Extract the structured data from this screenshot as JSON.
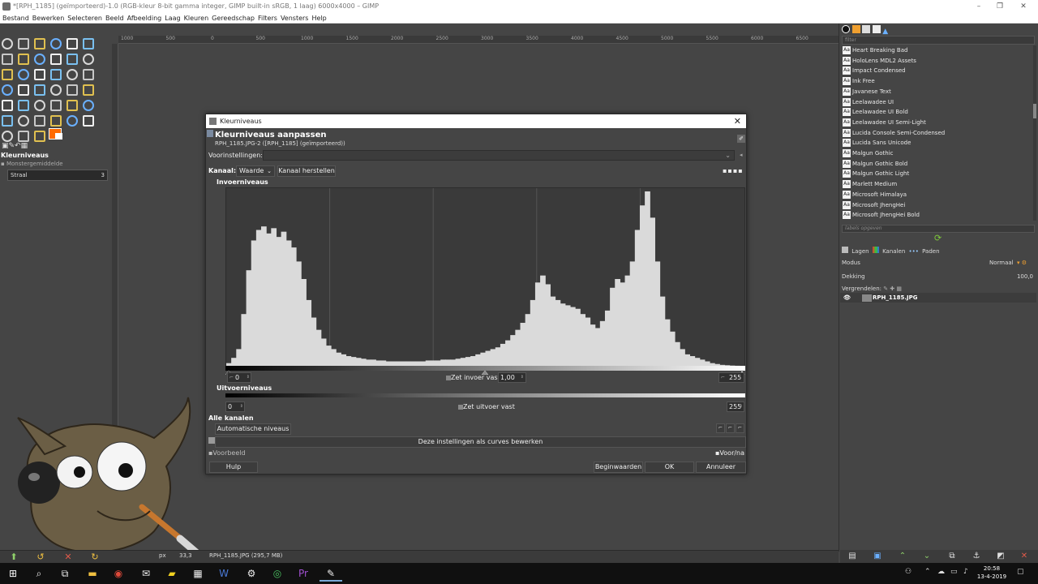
{
  "window": {
    "title": "*[RPH_1185] (geïmporteerd)-1.0 (RGB-kleur 8-bit gamma integer, GIMP built-in sRGB, 1 laag) 6000x4000 – GIMP",
    "minimize": "–",
    "maximize": "❐",
    "close": "✕"
  },
  "menu": [
    "Bestand",
    "Bewerken",
    "Selecteren",
    "Beeld",
    "Afbeelding",
    "Laag",
    "Kleuren",
    "Gereedschap",
    "Filters",
    "Vensters",
    "Help"
  ],
  "ruler": [
    "1000",
    "500",
    "0",
    "500",
    "1000",
    "1500",
    "2000",
    "2500",
    "3000",
    "3500",
    "4000",
    "4500",
    "5000",
    "5500",
    "6000",
    "6500"
  ],
  "toolbox": {
    "tool_options_title": "Kleurniveaus",
    "sample_average": "Monstergemiddelde",
    "radius_label": "Straal",
    "radius_value": "3"
  },
  "status": {
    "unit": "px",
    "zoom": "33,3",
    "file": "RPH_1185.JPG (295,7 MB)"
  },
  "fonts": {
    "filter_placeholder": "filter",
    "items": [
      "Heart Breaking Bad",
      "HoloLens MDL2 Assets",
      "Impact Condensed",
      "Ink Free",
      "Javanese Text",
      "Leelawadee UI",
      "Leelawadee UI Bold",
      "Leelawadee UI Semi-Light",
      "Lucida Console Semi-Condensed",
      "Lucida Sans Unicode",
      "Malgun Gothic",
      "Malgun Gothic Bold",
      "Malgun Gothic Light",
      "Marlett Medium",
      "Microsoft Himalaya",
      "Microsoft JhengHei",
      "Microsoft JhengHei Bold"
    ],
    "tags_placeholder": "labels opgeven"
  },
  "layers": {
    "tab_layers": "Lagen",
    "tab_channels": "Kanalen",
    "tab_paths": "Paden",
    "mode_label": "Modus",
    "mode_value": "Normaal",
    "opacity_label": "Dekking",
    "opacity_value": "100,0",
    "lock_label": "Vergrendelen:",
    "layer_name": "RPH_1185.JPG"
  },
  "dialog": {
    "title": "Kleurniveaus",
    "close": "✕",
    "heading": "Kleurniveaus aanpassen",
    "subheading": "RPH_1185.JPG-2 ([RPH_1185] (geïmporteerd))",
    "presets_label": "Voorinstellingen:",
    "channel_label": "Kanaal:",
    "channel_value": "Waarde",
    "reset_channel": "Kanaal herstellen",
    "input_levels": "Invoerniveaus",
    "input_black": "0",
    "gamma_label": "Zet invoer vast",
    "gamma_value": "1,00",
    "input_white": "255",
    "output_levels": "Uitvoerniveaus",
    "output_black": "0",
    "output_label": "Zet uitvoer vast",
    "output_white": "255",
    "all_channels": "Alle kanalen",
    "auto_levels": "Automatische niveaus",
    "edit_as_curves": "Deze instellingen als curves bewerken",
    "preview": "Voorbeeld",
    "split_view": "Voor/na",
    "help": "Hulp",
    "reset": "Beginwaarden",
    "ok": "OK",
    "cancel": "Annuleer"
  },
  "histogram": [
    0.02,
    0.05,
    0.1,
    0.3,
    0.55,
    0.72,
    0.78,
    0.8,
    0.76,
    0.79,
    0.74,
    0.77,
    0.72,
    0.68,
    0.6,
    0.5,
    0.38,
    0.28,
    0.21,
    0.16,
    0.12,
    0.1,
    0.08,
    0.07,
    0.06,
    0.055,
    0.05,
    0.045,
    0.04,
    0.04,
    0.035,
    0.035,
    0.03,
    0.03,
    0.03,
    0.03,
    0.03,
    0.03,
    0.03,
    0.03,
    0.035,
    0.035,
    0.035,
    0.04,
    0.04,
    0.04,
    0.045,
    0.05,
    0.055,
    0.06,
    0.07,
    0.08,
    0.09,
    0.1,
    0.11,
    0.13,
    0.15,
    0.18,
    0.21,
    0.25,
    0.3,
    0.38,
    0.48,
    0.52,
    0.47,
    0.4,
    0.38,
    0.36,
    0.35,
    0.34,
    0.33,
    0.3,
    0.28,
    0.24,
    0.22,
    0.26,
    0.32,
    0.45,
    0.5,
    0.48,
    0.52,
    0.6,
    0.78,
    0.92,
    1.0,
    0.85,
    0.6,
    0.4,
    0.27,
    0.2,
    0.14,
    0.1,
    0.07,
    0.06,
    0.05,
    0.04,
    0.03,
    0.02,
    0.015,
    0.01,
    0.008,
    0.006,
    0.005,
    0.004
  ],
  "taskbar": {
    "time": "20:58",
    "date": "13-4-2019"
  }
}
